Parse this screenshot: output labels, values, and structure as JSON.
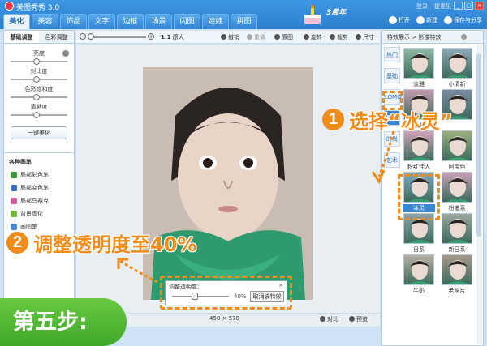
{
  "app": {
    "title": "美图秀秀 3.0",
    "anniversary": "3周年",
    "links": [
      "登录",
      "提意见"
    ]
  },
  "tabs": [
    "美化",
    "美容",
    "饰品",
    "文字",
    "边框",
    "场景",
    "闪图",
    "娃娃",
    "拼图"
  ],
  "top_actions": [
    "打开",
    "新建",
    "保存与分享"
  ],
  "left_panel": {
    "tabs": [
      "基础调整",
      "色彩调整"
    ],
    "sliders": [
      {
        "label": "亮度",
        "level": 0.5
      },
      {
        "label": "对比度",
        "level": 0.5
      },
      {
        "label": "色彩饱和度",
        "level": 0.5
      },
      {
        "label": "清晰度",
        "level": 0.5
      }
    ],
    "one_click": "一键美化",
    "brush_title": "各种画笔",
    "brushes": [
      {
        "label": "局部彩色笔",
        "color": "#3a9a3a"
      },
      {
        "label": "局部变色笔",
        "color": "#3a70c8"
      },
      {
        "label": "局部马赛克",
        "color": "#d65a9b"
      },
      {
        "label": "背景虚化",
        "color": "#6fb83a"
      },
      {
        "label": "画图笔",
        "color": "#4a88d6"
      }
    ]
  },
  "toolbar": {
    "ratio": "1:1",
    "original_size": "原大",
    "undo": "撤销",
    "redo": "重做",
    "original_image": "原图",
    "rotate": "旋转",
    "crop": "裁剪",
    "dimensions": "尺寸"
  },
  "status": {
    "size_w": "450",
    "size_h": "578",
    "compare": "对比",
    "preview": "预览"
  },
  "dialog": {
    "title": "调整透明度：",
    "close": "×",
    "value": "40%",
    "level": 0.4,
    "cancel": "取消该特效"
  },
  "right_panel": {
    "header": "特效展示 > 影楼特效",
    "categories": [
      "热门",
      "基础",
      "LOMO",
      "影楼",
      "时尚",
      "艺术"
    ],
    "active_category": "影楼",
    "effects": [
      "淡雅",
      "小清新",
      "经典",
      "",
      "粉红佳人",
      "阿宝色",
      "冰灵",
      "粉嫩系",
      "日系",
      "新日系",
      "牛奶",
      "老照片"
    ],
    "selected_effect": "冰灵"
  },
  "callouts": {
    "step1_num": "1",
    "step1_text": "选择“冰灵”",
    "step2_num": "2",
    "step2_text": "调整透明度至40%",
    "step_label": "第五步:"
  },
  "colors": {
    "accent": "#f08c1a",
    "brand_blue": "#2a7fcf",
    "step_green": "#4cb531"
  }
}
